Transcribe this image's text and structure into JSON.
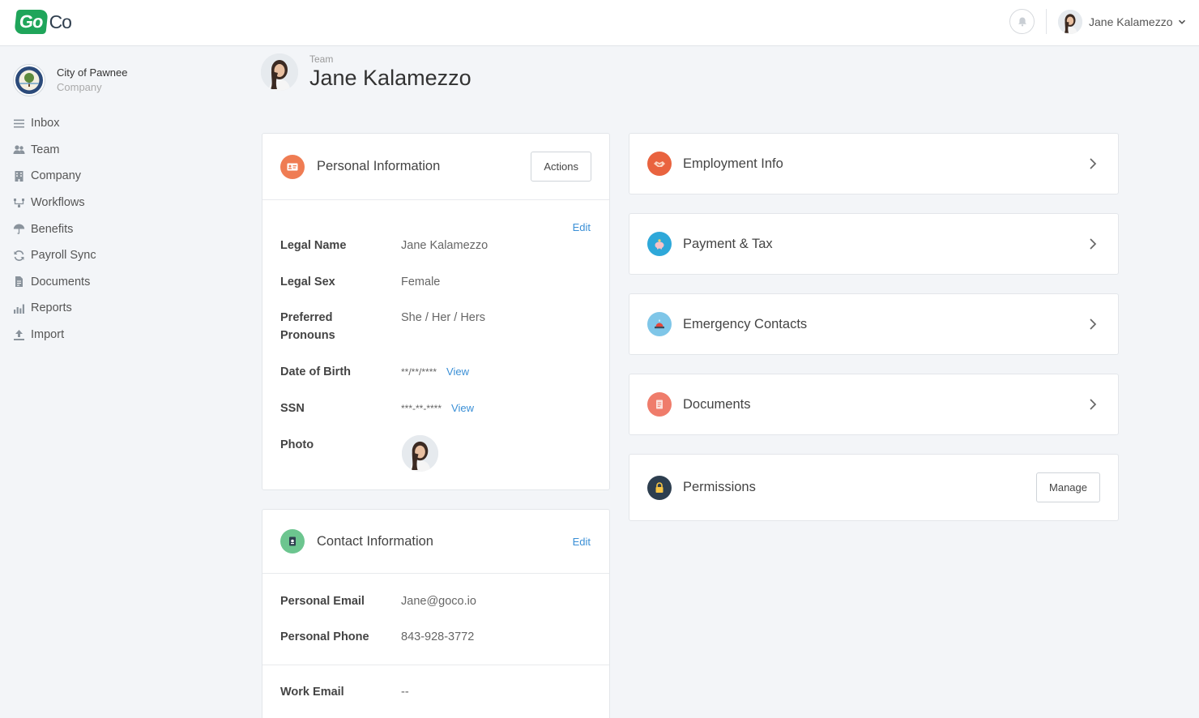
{
  "brand": {
    "logo_go": "Go",
    "logo_co": "Co",
    "green": "#1fa55a"
  },
  "topbar": {
    "user_name": "Jane Kalamezzo",
    "bell_icon": "bell-icon",
    "dropdown_icon": "chevron-down-icon"
  },
  "sidebar": {
    "company_name": "City of Pawnee",
    "company_sub": "Company",
    "items": [
      {
        "label": "Inbox",
        "icon": "inbox-icon"
      },
      {
        "label": "Team",
        "icon": "team-icon"
      },
      {
        "label": "Company",
        "icon": "building-icon"
      },
      {
        "label": "Workflows",
        "icon": "workflow-icon"
      },
      {
        "label": "Benefits",
        "icon": "umbrella-icon"
      },
      {
        "label": "Payroll Sync",
        "icon": "sync-icon"
      },
      {
        "label": "Documents",
        "icon": "document-icon"
      },
      {
        "label": "Reports",
        "icon": "bar-chart-icon"
      },
      {
        "label": "Import",
        "icon": "upload-icon"
      }
    ]
  },
  "header": {
    "breadcrumb": "Team",
    "name": "Jane Kalamezzo"
  },
  "personal": {
    "title": "Personal Information",
    "actions_label": "Actions",
    "edit_label": "Edit",
    "legal_name_label": "Legal Name",
    "legal_name": "Jane Kalamezzo",
    "legal_sex_label": "Legal Sex",
    "legal_sex": "Female",
    "pronouns_label": "Preferred Pronouns",
    "pronouns": "She / Her / Hers",
    "dob_label": "Date of Birth",
    "dob": "**/**/****",
    "dob_view": "View",
    "ssn_label": "SSN",
    "ssn": "***-**-****",
    "ssn_view": "View",
    "photo_label": "Photo"
  },
  "contact": {
    "title": "Contact Information",
    "edit_label": "Edit",
    "personal_email_label": "Personal Email",
    "personal_email": "Jane@goco.io",
    "personal_phone_label": "Personal Phone",
    "personal_phone": "843-928-3772",
    "work_email_label": "Work Email",
    "work_email": "--"
  },
  "panels": {
    "employment": "Employment Info",
    "payment": "Payment & Tax",
    "emergency": "Emergency Contacts",
    "documents": "Documents",
    "permissions": "Permissions",
    "manage_label": "Manage"
  },
  "colors": {
    "personal": "#ef7c53",
    "contact": "#6cc58f",
    "employment": "#e9633f",
    "payment": "#2ea8d9",
    "emergency": "#7fc6e8",
    "documents": "#ef7c6b",
    "permissions": "#2d3e4f",
    "link": "#3a8fd6"
  }
}
